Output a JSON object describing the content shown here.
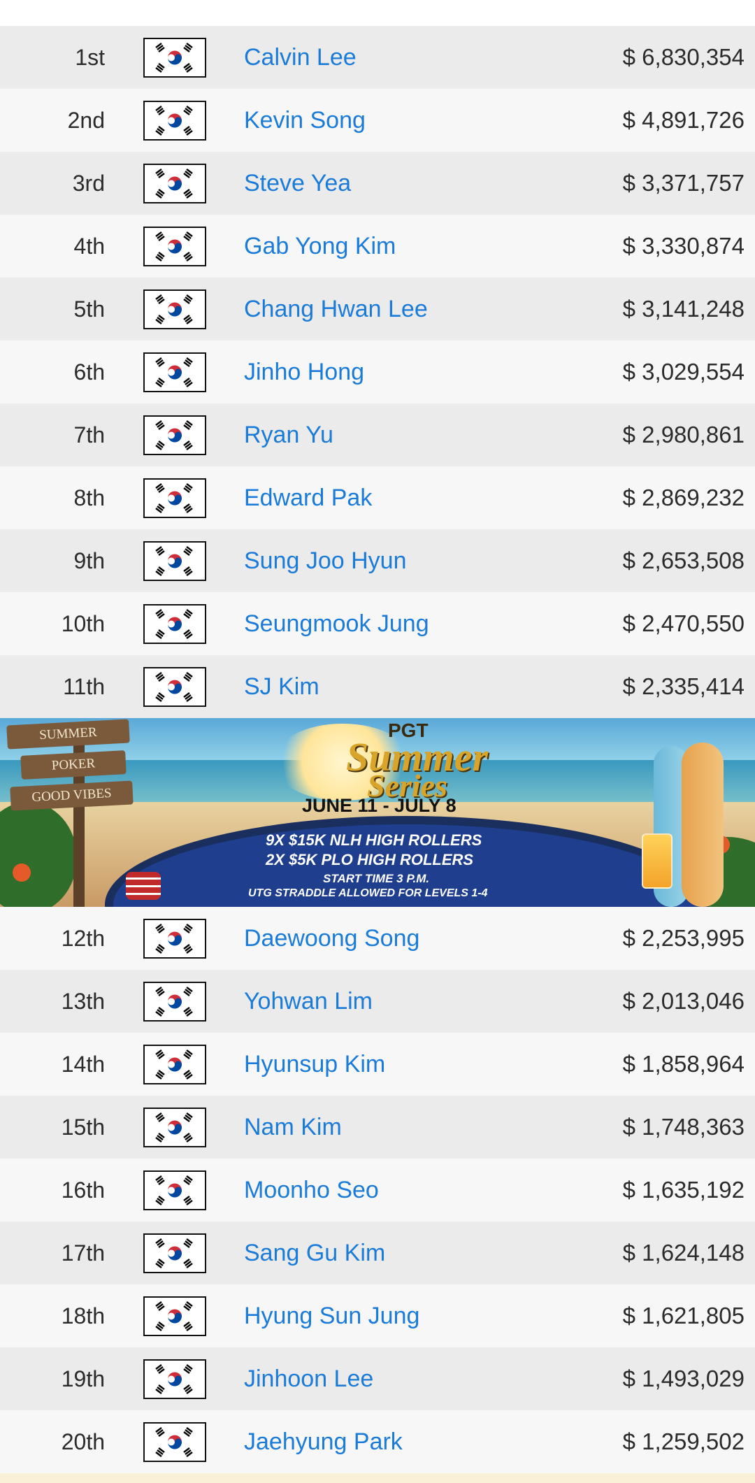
{
  "rows_top": [
    {
      "rank": "1st",
      "name": "Calvin Lee",
      "amount": "$ 6,830,354"
    },
    {
      "rank": "2nd",
      "name": "Kevin Song",
      "amount": "$ 4,891,726"
    },
    {
      "rank": "3rd",
      "name": "Steve Yea",
      "amount": "$ 3,371,757"
    },
    {
      "rank": "4th",
      "name": "Gab Yong Kim",
      "amount": "$ 3,330,874"
    },
    {
      "rank": "5th",
      "name": "Chang Hwan Lee",
      "amount": "$ 3,141,248"
    },
    {
      "rank": "6th",
      "name": "Jinho Hong",
      "amount": "$ 3,029,554"
    },
    {
      "rank": "7th",
      "name": "Ryan Yu",
      "amount": "$ 2,980,861"
    },
    {
      "rank": "8th",
      "name": "Edward Pak",
      "amount": "$ 2,869,232"
    },
    {
      "rank": "9th",
      "name": "Sung Joo Hyun",
      "amount": "$ 2,653,508"
    },
    {
      "rank": "10th",
      "name": "Seungmook Jung",
      "amount": "$ 2,470,550"
    },
    {
      "rank": "11th",
      "name": "SJ Kim",
      "amount": "$ 2,335,414"
    }
  ],
  "banner": {
    "sign1": "SUMMER",
    "sign2": "POKER",
    "sign3": "GOOD VIBES",
    "brand": "PGT",
    "title_line1": "Summer",
    "title_line2": "Series",
    "dates": "JUNE 11 - JULY 8",
    "line1": "9X $15K NLH HIGH ROLLERS",
    "line2": "2X $5K PLO HIGH ROLLERS",
    "line3": "START TIME 3 P.M.",
    "line4": "UTG STRADDLE ALLOWED FOR LEVELS 1-4"
  },
  "rows_bottom": [
    {
      "rank": "12th",
      "name": "Daewoong Song",
      "amount": "$ 2,253,995"
    },
    {
      "rank": "13th",
      "name": "Yohwan Lim",
      "amount": "$ 2,013,046"
    },
    {
      "rank": "14th",
      "name": "Hyunsup Kim",
      "amount": "$ 1,858,964"
    },
    {
      "rank": "15th",
      "name": "Nam Kim",
      "amount": "$ 1,748,363"
    },
    {
      "rank": "16th",
      "name": "Moonho Seo",
      "amount": "$ 1,635,192"
    },
    {
      "rank": "17th",
      "name": "Sang Gu Kim",
      "amount": "$ 1,624,148"
    },
    {
      "rank": "18th",
      "name": "Hyung Sun Jung",
      "amount": "$ 1,621,805"
    },
    {
      "rank": "19th",
      "name": "Jinhoon Lee",
      "amount": "$ 1,493,029"
    },
    {
      "rank": "20th",
      "name": "Jaehyung Park",
      "amount": "$ 1,259,502"
    }
  ],
  "flag_icon": "south-korea-flag-icon",
  "colors": {
    "link": "#1a7bd8",
    "row_odd": "#ebebeb",
    "row_even": "#f7f7f7",
    "text": "#2b2b2b"
  }
}
